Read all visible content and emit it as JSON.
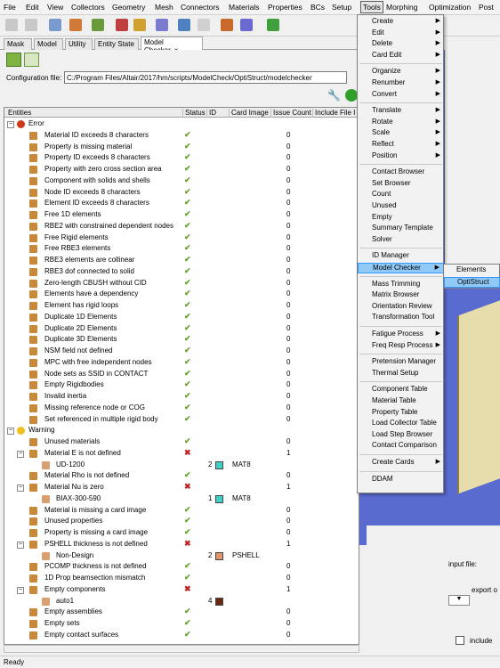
{
  "menubar": [
    "File",
    "Edit",
    "View",
    "Collectors",
    "Geometry",
    "Mesh",
    "Connectors",
    "Materials",
    "Properties",
    "BCs",
    "Setup",
    "Tools",
    "Morphing",
    "Optimization",
    "Post"
  ],
  "tabs": [
    "Mask",
    "Model",
    "Utility",
    "Entity State",
    "Model Checker"
  ],
  "tab_close": "×",
  "config": {
    "label": "Configuration file:",
    "value": "C:/Program Files/Altair/2017/hm/scripts/ModelCheck/OptiStruct/modelchecker"
  },
  "columns": [
    "Entities",
    "Status",
    "ID",
    "Card Image",
    "Issue Count",
    "Include File I"
  ],
  "rows": [
    {
      "t": "g",
      "label": "Error",
      "lvl": 0,
      "icon": "error"
    },
    {
      "label": "Material ID exceeds 8 characters",
      "st": "ok",
      "cnt": "0"
    },
    {
      "label": "Property is missing material",
      "st": "ok",
      "cnt": "0"
    },
    {
      "label": "Property ID exceeds 8 characters",
      "st": "ok",
      "cnt": "0"
    },
    {
      "label": "Property with zero cross section area",
      "st": "ok",
      "cnt": "0"
    },
    {
      "label": "Component with solids and shells",
      "st": "ok",
      "cnt": "0"
    },
    {
      "label": "Node ID exceeds 8 characters",
      "st": "ok",
      "cnt": "0"
    },
    {
      "label": "Element ID exceeds 8 characters",
      "st": "ok",
      "cnt": "0"
    },
    {
      "label": "Free 1D elements",
      "st": "ok",
      "cnt": "0"
    },
    {
      "label": "RBE2 with constrained dependent nodes",
      "st": "ok",
      "cnt": "0"
    },
    {
      "label": "Free Rigid elements",
      "st": "ok",
      "cnt": "0"
    },
    {
      "label": "Free RBE3 elements",
      "st": "ok",
      "cnt": "0"
    },
    {
      "label": "RBE3 elements are collinear",
      "st": "ok",
      "cnt": "0"
    },
    {
      "label": "RBE3 dof connected to solid",
      "st": "ok",
      "cnt": "0"
    },
    {
      "label": "Zero-length CBUSH without CID",
      "st": "ok",
      "cnt": "0"
    },
    {
      "label": "Elements have a dependency",
      "st": "ok",
      "cnt": "0"
    },
    {
      "label": "Element has rigid loops",
      "st": "ok",
      "cnt": "0"
    },
    {
      "label": "Duplicate 1D Elements",
      "st": "ok",
      "cnt": "0"
    },
    {
      "label": "Duplicate 2D Elements",
      "st": "ok",
      "cnt": "0"
    },
    {
      "label": "Duplicate 3D Elements",
      "st": "ok",
      "cnt": "0"
    },
    {
      "label": "NSM field not defined",
      "st": "ok",
      "cnt": "0"
    },
    {
      "label": "MPC with free independent nodes",
      "st": "ok",
      "cnt": "0"
    },
    {
      "label": "Node sets as SSID in CONTACT",
      "st": "ok",
      "cnt": "0"
    },
    {
      "label": "Empty Rigidbodies",
      "st": "ok",
      "cnt": "0"
    },
    {
      "label": "Invalid inertia",
      "st": "ok",
      "cnt": "0"
    },
    {
      "label": "Missing reference node or COG",
      "st": "ok",
      "cnt": "0"
    },
    {
      "label": "Set referenced in multiple rigid body",
      "st": "ok",
      "cnt": "0"
    },
    {
      "t": "g",
      "label": "Warning",
      "lvl": 0,
      "icon": "warning"
    },
    {
      "label": "Unused materials",
      "st": "ok",
      "cnt": "0"
    },
    {
      "label": "Material E is not defined",
      "st": "err",
      "cnt": "1",
      "exp": true
    },
    {
      "label": "UD-1200",
      "sub": true,
      "id": "2",
      "color": "#3fd0c8",
      "card": "MAT8"
    },
    {
      "label": "Material Rho is not defined",
      "st": "ok",
      "cnt": "0"
    },
    {
      "label": "Material Nu is zero",
      "st": "err",
      "cnt": "1",
      "exp": true
    },
    {
      "label": "BIAX-300-590",
      "sub": true,
      "id": "1",
      "color": "#3fd0c8",
      "card": "MAT8"
    },
    {
      "label": "Material is missing a card image",
      "st": "ok",
      "cnt": "0"
    },
    {
      "label": "Unused properties",
      "st": "ok",
      "cnt": "0"
    },
    {
      "label": "Property is missing a card image",
      "st": "ok",
      "cnt": "0"
    },
    {
      "label": "PSHELL thickness is not defined",
      "st": "err",
      "cnt": "1",
      "exp": true
    },
    {
      "label": "Non-Design",
      "sub": true,
      "id": "2",
      "color": "#e0956c",
      "card": "PSHELL"
    },
    {
      "label": "PCOMP thickness is not defined",
      "st": "ok",
      "cnt": "0"
    },
    {
      "label": "1D Prop beamsection mismatch",
      "st": "ok",
      "cnt": "0"
    },
    {
      "label": "Empty components",
      "st": "err",
      "cnt": "1",
      "exp": true
    },
    {
      "label": "auto1",
      "sub": true,
      "id": "4",
      "color": "#6b2a10",
      "card": ""
    },
    {
      "label": "Empty assemblies",
      "st": "ok",
      "cnt": "0"
    },
    {
      "label": "Empty sets",
      "st": "ok",
      "cnt": "0"
    },
    {
      "label": "Empty contact surfaces",
      "st": "ok",
      "cnt": "0"
    }
  ],
  "tools_menu": [
    {
      "label": "Create",
      "arrow": true
    },
    {
      "label": "Edit",
      "arrow": true
    },
    {
      "label": "Delete",
      "arrow": true
    },
    {
      "label": "Card Edit",
      "arrow": true
    },
    {
      "sep": true
    },
    {
      "label": "Organize",
      "arrow": true
    },
    {
      "label": "Renumber",
      "arrow": true
    },
    {
      "label": "Convert",
      "arrow": true
    },
    {
      "sep": true
    },
    {
      "label": "Translate",
      "arrow": true
    },
    {
      "label": "Rotate",
      "arrow": true
    },
    {
      "label": "Scale",
      "arrow": true
    },
    {
      "label": "Reflect",
      "arrow": true
    },
    {
      "label": "Position",
      "arrow": true
    },
    {
      "sep": true
    },
    {
      "label": "Contact Browser"
    },
    {
      "label": "Set Browser"
    },
    {
      "label": "Count"
    },
    {
      "label": "Unused"
    },
    {
      "label": "Empty"
    },
    {
      "label": "Summary Template"
    },
    {
      "label": "Solver"
    },
    {
      "sep": true
    },
    {
      "label": "ID Manager"
    },
    {
      "label": "Model Checker",
      "arrow": true,
      "hl": true
    },
    {
      "sep": true
    },
    {
      "label": "Mass Trimming"
    },
    {
      "label": "Matrix Browser"
    },
    {
      "label": "Orientation Review"
    },
    {
      "label": "Transformation Tool"
    },
    {
      "sep": true
    },
    {
      "label": "Fatigue Process",
      "arrow": true
    },
    {
      "label": "Freq Resp Process",
      "arrow": true
    },
    {
      "sep": true
    },
    {
      "label": "Pretension Manager"
    },
    {
      "label": "Thermal Setup"
    },
    {
      "sep": true
    },
    {
      "label": "Component Table"
    },
    {
      "label": "Material Table"
    },
    {
      "label": "Property Table"
    },
    {
      "label": "Load Collector Table"
    },
    {
      "label": "Load Step Browser"
    },
    {
      "label": "Contact Comparison"
    },
    {
      "sep": true
    },
    {
      "label": "Create Cards",
      "arrow": true
    },
    {
      "sep": true
    },
    {
      "label": "DDAM"
    }
  ],
  "submenu": [
    "Elements",
    "OptiStruct"
  ],
  "right_panel": {
    "input_file": "input file:",
    "export": "export o",
    "include": "include"
  },
  "status": "Ready"
}
